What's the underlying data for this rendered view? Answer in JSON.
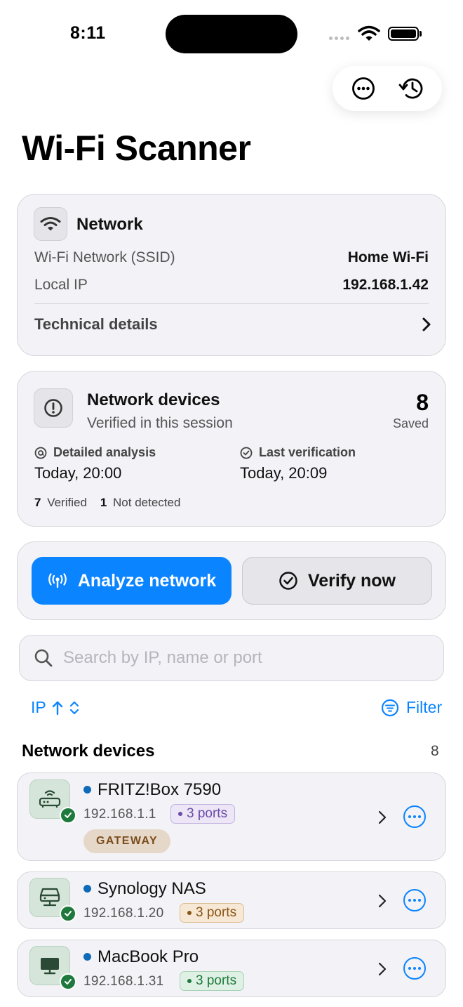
{
  "status": {
    "time": "8:11"
  },
  "app": {
    "title": "Wi-Fi Scanner"
  },
  "network": {
    "title": "Network",
    "ssid_label": "Wi-Fi Network (SSID)",
    "ssid_value": "Home Wi-Fi",
    "ip_label": "Local IP",
    "ip_value": "192.168.1.42",
    "technical_details": "Technical details"
  },
  "devices_summary": {
    "title": "Network devices",
    "subtitle": "Verified in this session",
    "count": "8",
    "count_label": "Saved",
    "analysis_label": "Detailed analysis",
    "analysis_value": "Today, 20:00",
    "verification_label": "Last verification",
    "verification_value": "Today, 20:09",
    "verified_count": "7",
    "verified_label": "Verified",
    "not_detected_count": "1",
    "not_detected_label": "Not detected"
  },
  "actions": {
    "analyze": "Analyze network",
    "verify": "Verify now"
  },
  "search": {
    "placeholder": "Search by IP, name or port"
  },
  "sort": {
    "label": "IP",
    "direction": "ascending"
  },
  "filter": {
    "label": "Filter"
  },
  "device_list": {
    "title": "Network devices",
    "count": "8",
    "items": [
      {
        "name": "FRITZ!Box 7590",
        "ip": "192.168.1.1",
        "ports": "3 ports",
        "badge": "GATEWAY",
        "icon": "router-icon",
        "port_color": "#6b4ba6"
      },
      {
        "name": "Synology NAS",
        "ip": "192.168.1.20",
        "ports": "3 ports",
        "icon": "nas-icon",
        "port_color": "#8a5414"
      },
      {
        "name": "MacBook Pro",
        "ip": "192.168.1.31",
        "ports": "3 ports",
        "icon": "desktop-icon",
        "port_color": "#1e7a3c"
      }
    ]
  },
  "colors": {
    "accent": "#0a84ff",
    "verified": "#1e7a3c",
    "online_dot": "#0f6ab8"
  }
}
